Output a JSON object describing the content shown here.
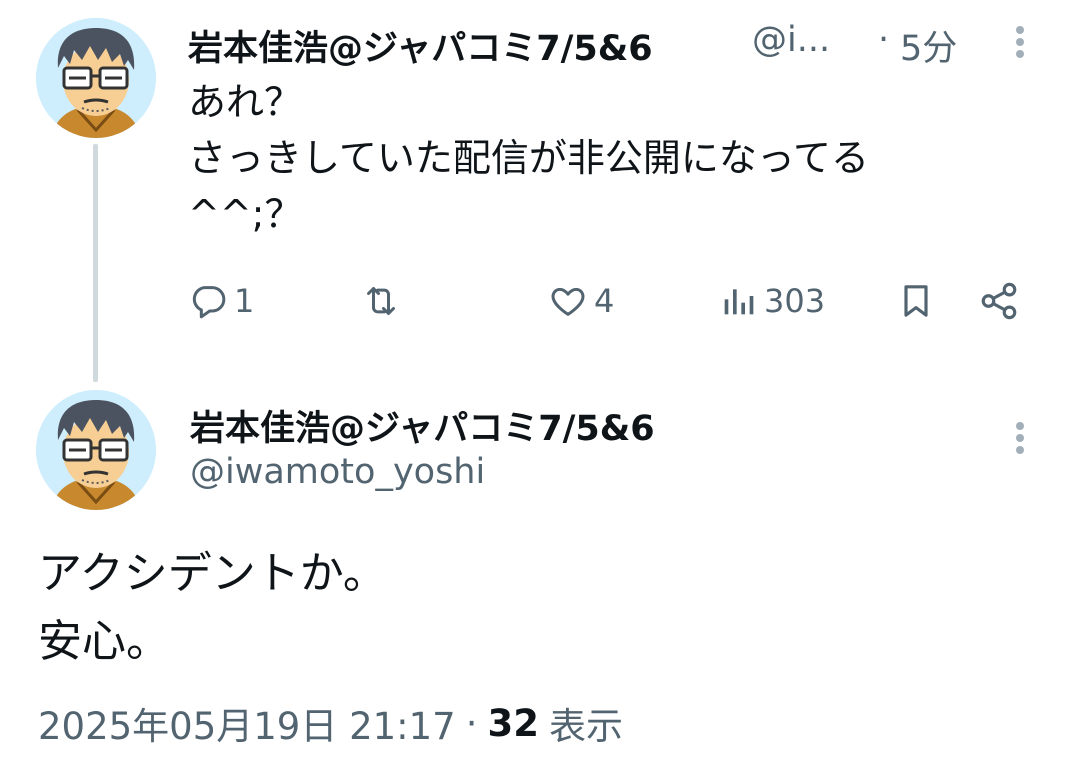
{
  "reply_tweet": {
    "display_name": "岩本佳浩@ジャパコミ7/5&6",
    "handle": "@i...",
    "separator": "·",
    "time": "5分",
    "text": "あれ？\nさっきしていた配信が非公開になってる\n^^;？",
    "replies": "1",
    "likes": "4",
    "views": "303"
  },
  "main_tweet": {
    "display_name": "岩本佳浩@ジャパコミ7/5&6",
    "handle": "@iwamoto_yoshi",
    "text": "アクシデントか。\n安心。",
    "timestamp": "2025年05月19日 21:17",
    "separator": "·",
    "views_count": "32",
    "views_label": "表示"
  },
  "colors": {
    "text": "#0f1419",
    "secondary": "#536471",
    "thread_line": "#cfd9de"
  },
  "icons": [
    "reply-icon",
    "retweet-icon",
    "like-icon",
    "views-icon",
    "bookmark-icon",
    "share-icon",
    "more-icon"
  ]
}
